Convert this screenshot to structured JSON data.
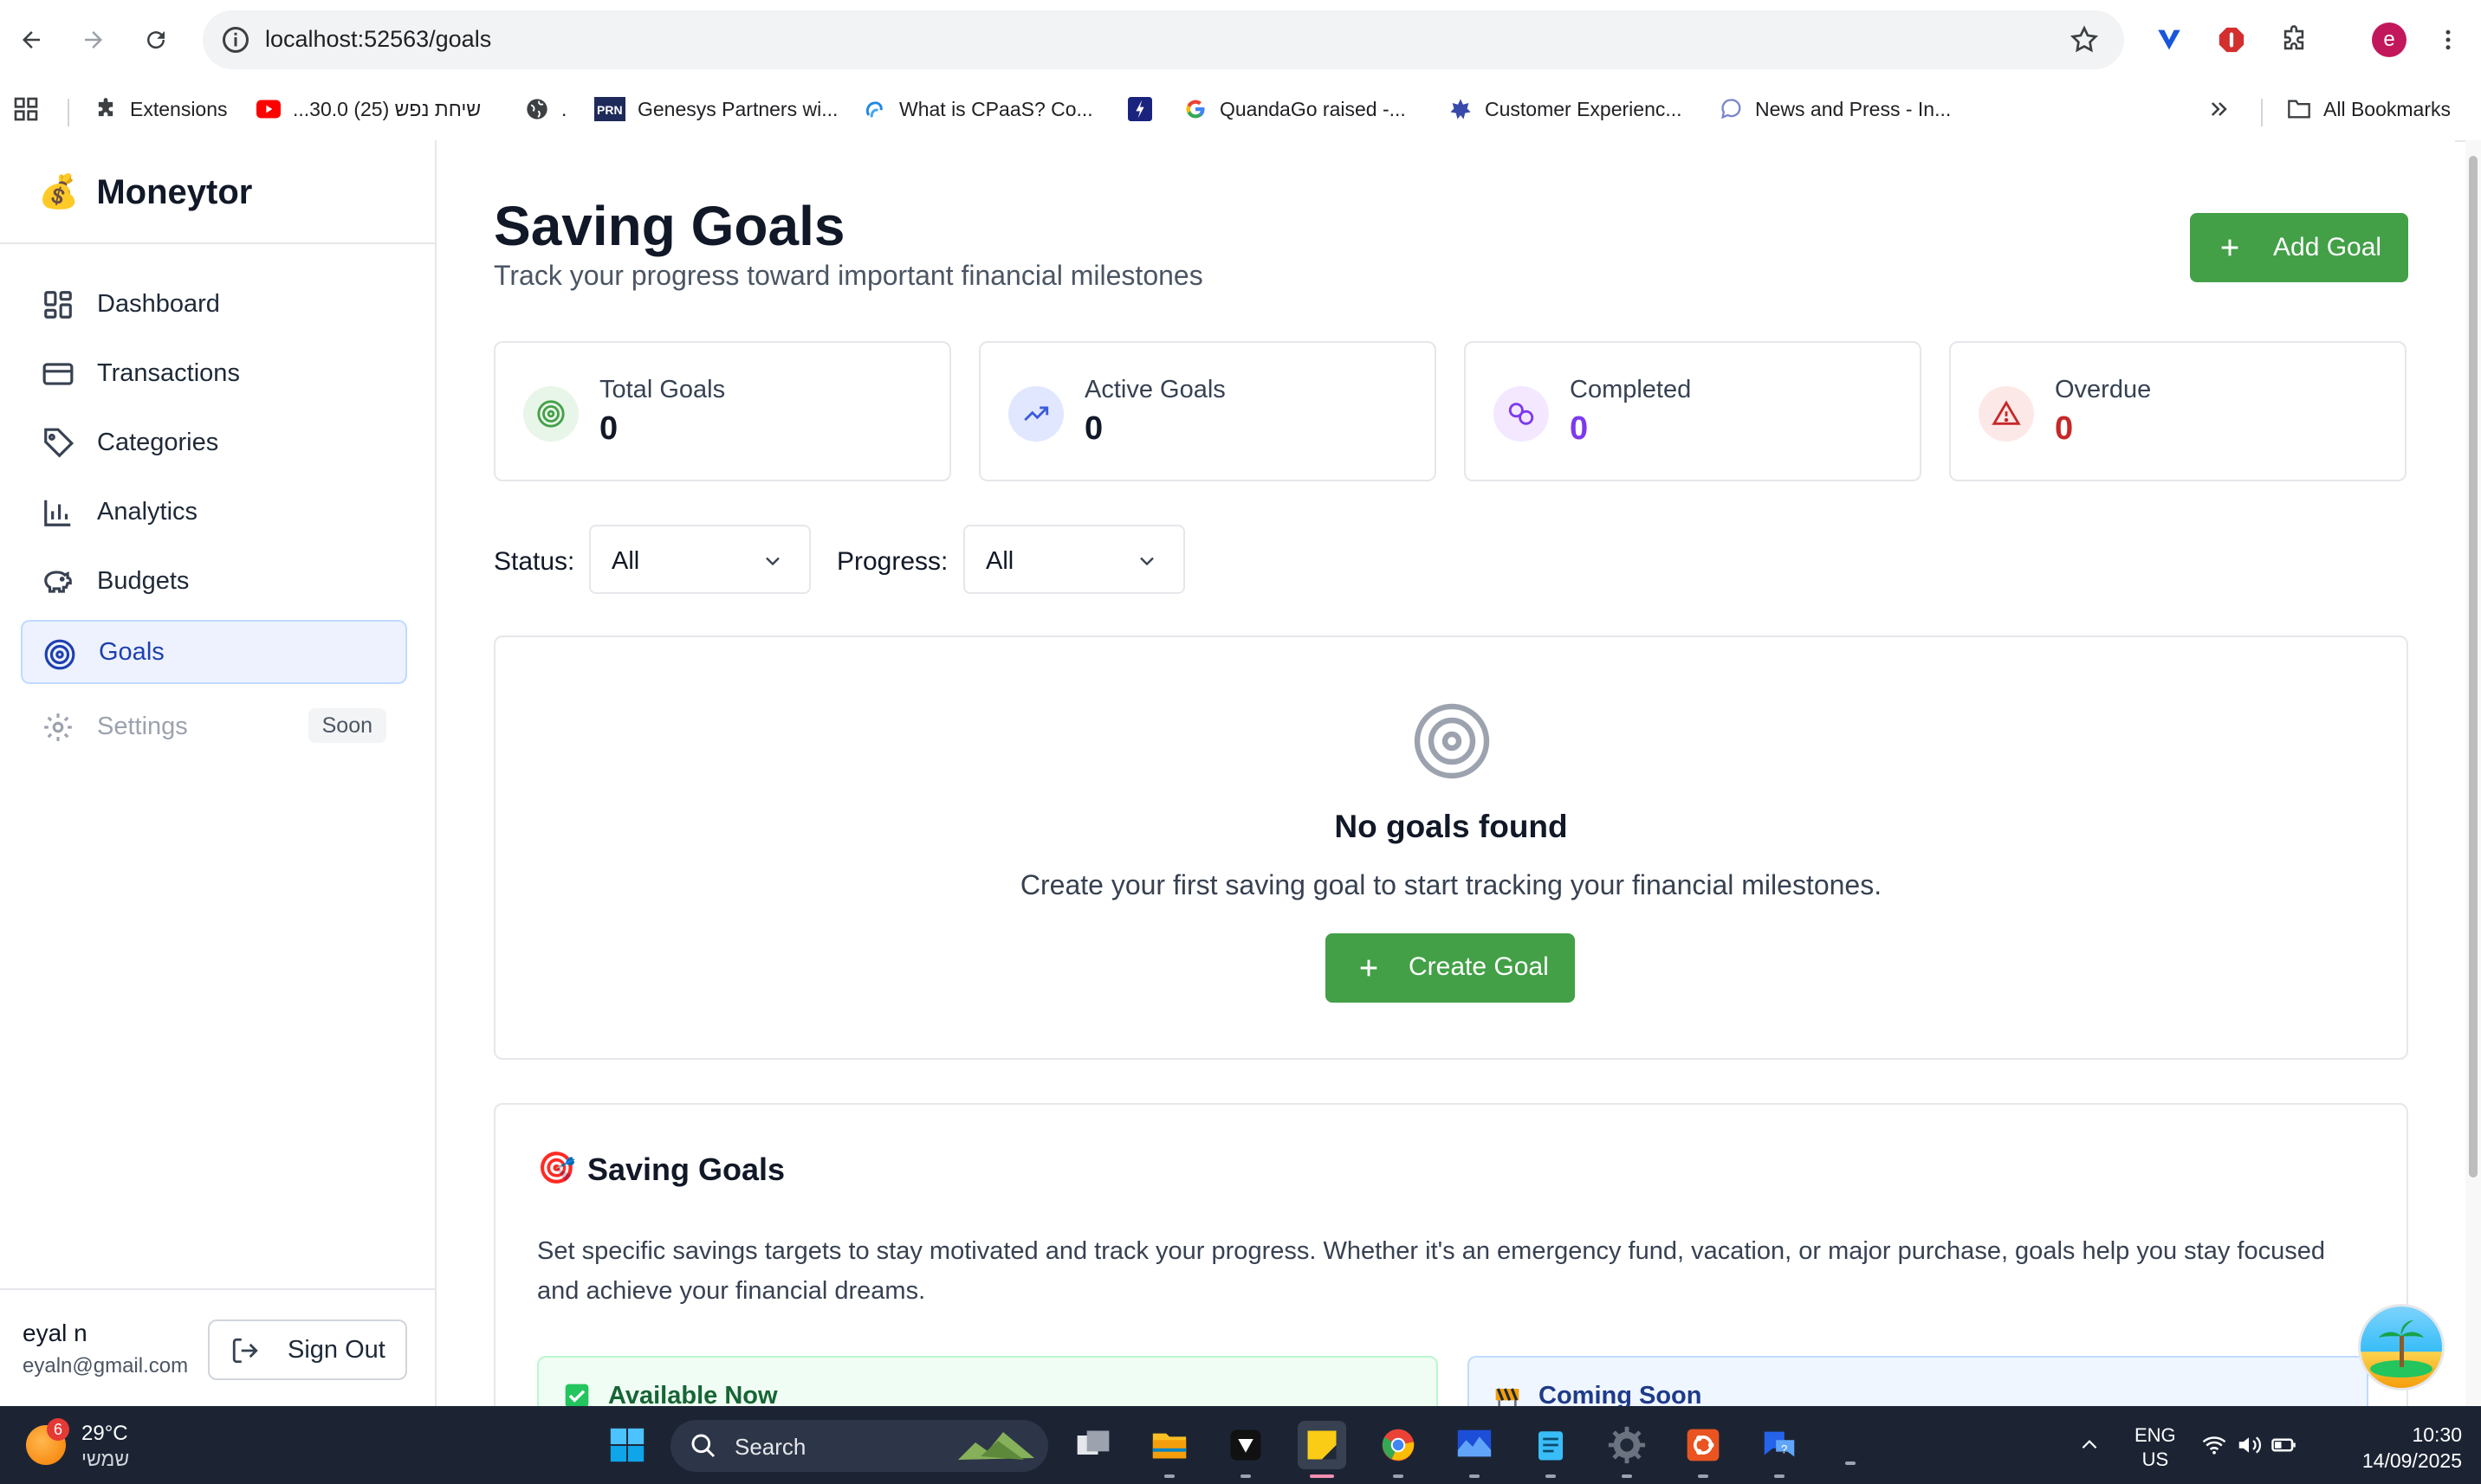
{
  "browser": {
    "url": "localhost:52563/goals",
    "profile_initial": "e",
    "bookmarks": [
      {
        "label": "Extensions",
        "icon": "puzzle-icon"
      },
      {
        "label": "...30.0 שיחת נפש (25)",
        "icon": "youtube-icon"
      },
      {
        "label": ".",
        "icon": "globe-icon"
      },
      {
        "label": "Genesys Partners wi...",
        "icon": "prn-icon"
      },
      {
        "label": "What is CPaaS? Co...",
        "icon": "cpaas-icon"
      },
      {
        "label": "",
        "icon": "bolt-icon"
      },
      {
        "label": "QuandaGo raised -...",
        "icon": "google-icon"
      },
      {
        "label": "Customer Experienc...",
        "icon": "gear-star-icon"
      },
      {
        "label": "News and Press - In...",
        "icon": "chat-icon"
      }
    ],
    "all_bookmarks": "All Bookmarks"
  },
  "sidebar": {
    "brand": "Moneytor",
    "brand_icon": "💰",
    "items": [
      {
        "label": "Dashboard",
        "icon": "dashboard-icon"
      },
      {
        "label": "Transactions",
        "icon": "credit-card-icon"
      },
      {
        "label": "Categories",
        "icon": "tag-icon"
      },
      {
        "label": "Analytics",
        "icon": "bar-chart-icon"
      },
      {
        "label": "Budgets",
        "icon": "piggy-bank-icon"
      },
      {
        "label": "Goals",
        "icon": "target-icon",
        "active": true
      },
      {
        "label": "Settings",
        "icon": "settings-icon",
        "badge": "Soon",
        "disabled": true
      }
    ],
    "user": {
      "name": "eyal n",
      "email": "eyaln@gmail.com"
    },
    "sign_out": "Sign Out"
  },
  "page": {
    "title": "Saving Goals",
    "subtitle": "Track your progress toward important financial milestones",
    "add_button": "Add Goal"
  },
  "stats": [
    {
      "label": "Total Goals",
      "value": "0",
      "color": "#111827",
      "icon_bg": "#e8f5e9",
      "icon": "target-icon"
    },
    {
      "label": "Active Goals",
      "value": "0",
      "color": "#111827",
      "icon_bg": "#e0e7ff",
      "icon": "trending-up-icon"
    },
    {
      "label": "Completed",
      "value": "0",
      "color": "#7c3aed",
      "icon_bg": "#f3e8ff",
      "icon": "link-icon"
    },
    {
      "label": "Overdue",
      "value": "0",
      "color": "#c62828",
      "icon_bg": "#fde8e8",
      "icon": "alert-triangle-icon"
    }
  ],
  "filters": {
    "status_label": "Status:",
    "status_value": "All",
    "progress_label": "Progress:",
    "progress_value": "All"
  },
  "empty": {
    "title": "No goals found",
    "description": "Create your first saving goal to start tracking your financial milestones.",
    "button": "Create Goal"
  },
  "info": {
    "emoji": "🎯",
    "title": "Saving Goals",
    "description": "Set specific savings targets to stay motivated and track your progress. Whether it's an emergency fund, vacation, or major purchase, goals help you stay focused and achieve your financial dreams.",
    "available": "Available Now",
    "coming_soon": "Coming Soon"
  },
  "taskbar": {
    "weather_temp": "29°C",
    "weather_loc": "שמשי",
    "weather_badge": "6",
    "search": "Search",
    "lang_top": "ENG",
    "lang_bottom": "US",
    "time": "10:30",
    "date": "14/09/2025"
  },
  "colors": {
    "accent_green": "#43a047",
    "active_nav": "#eef2ff",
    "completed": "#7c3aed",
    "overdue": "#c62828"
  }
}
